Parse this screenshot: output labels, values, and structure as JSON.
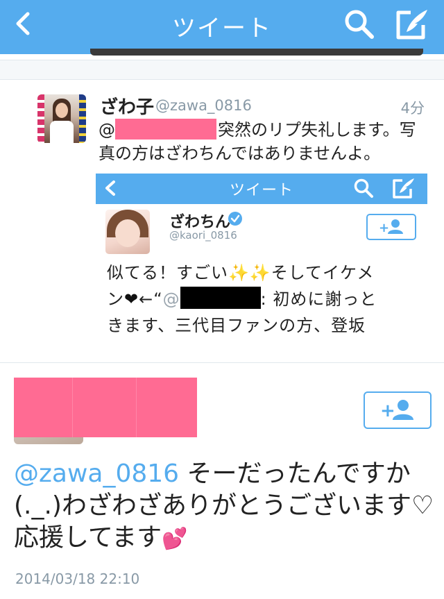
{
  "navbar": {
    "title": "ツイート",
    "icons": {
      "back": "chevron-left-icon",
      "search": "search-icon",
      "compose": "compose-icon"
    }
  },
  "parent_tweet": {
    "name": "ざわ子",
    "handle": "@zawa_0816",
    "time": "4分",
    "text_prefix": "@",
    "text_after_redaction": "突然のリプ失礼します。写真の方はざわちんではありませんよ。"
  },
  "embedded_screenshot": {
    "title": "ツイート",
    "name": "ざわちん",
    "handle": "@kaori_0816",
    "line1": "似てる！すごい",
    "sparkles": "✨✨",
    "line1_end": "そしてイケメ",
    "line2_start": "ン",
    "heart": "❤",
    "line2_arrow": "←“",
    "line2_at": "@",
    "line2_after": ": 初めに謝っと",
    "line3": "きます、三代目ファンの方、登坂"
  },
  "reply_tweet": {
    "mention": "@zawa_0816",
    "text": " そーだったんですか(._.)わざわざありがとうございます♡応援してます",
    "emoji": "💕",
    "timestamp": "2014/03/18 22:10"
  },
  "colors": {
    "brand": "#55acee",
    "redaction_pink": "#ff6b93",
    "meta_gray": "#8899a6"
  }
}
